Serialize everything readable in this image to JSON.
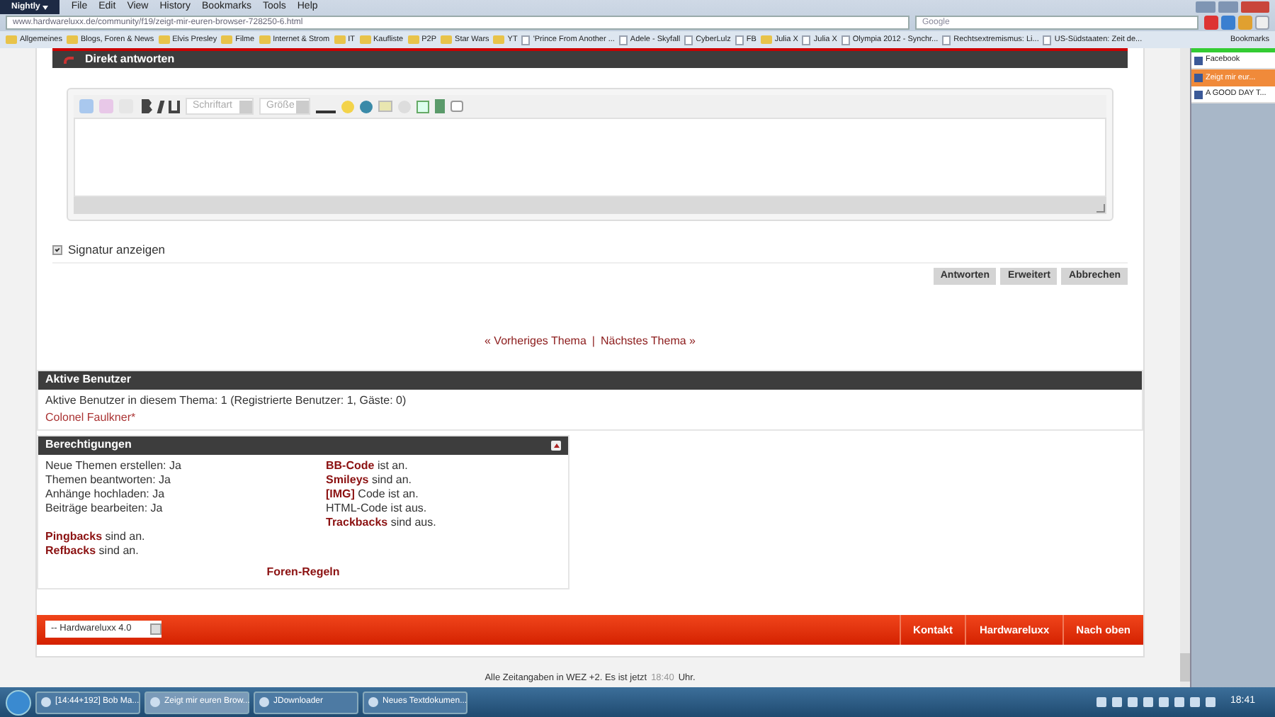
{
  "browser": {
    "app_button": "Nightly",
    "menu": [
      "File",
      "Edit",
      "View",
      "History",
      "Bookmarks",
      "Tools",
      "Help"
    ],
    "url": "www.hardwareluxx.de/community/f19/zeigt-mir-euren-browser-728250-6.html",
    "search_placeholder": "Google",
    "bookmarks": [
      {
        "label": "Allgemeines",
        "kind": "folder"
      },
      {
        "label": "Blogs, Foren & News",
        "kind": "folder"
      },
      {
        "label": "Elvis Presley",
        "kind": "folder"
      },
      {
        "label": "Filme",
        "kind": "folder"
      },
      {
        "label": "Internet & Strom",
        "kind": "folder"
      },
      {
        "label": "IT",
        "kind": "folder"
      },
      {
        "label": "Kaufliste",
        "kind": "folder"
      },
      {
        "label": "P2P",
        "kind": "folder"
      },
      {
        "label": "Star Wars",
        "kind": "folder"
      },
      {
        "label": "YT",
        "kind": "folder"
      },
      {
        "label": "'Prince From Another ...",
        "kind": "page"
      },
      {
        "label": "Adele - Skyfall",
        "kind": "page"
      },
      {
        "label": "CyberLulz",
        "kind": "page"
      },
      {
        "label": "FB",
        "kind": "page"
      },
      {
        "label": "Julia X",
        "kind": "folder"
      },
      {
        "label": "Julia X",
        "kind": "page"
      },
      {
        "label": "Olympia 2012 - Synchr...",
        "kind": "page"
      },
      {
        "label": "Rechtsextremismus: Li...",
        "kind": "page"
      },
      {
        "label": "US-Südstaaten: Zeit de...",
        "kind": "page"
      }
    ],
    "bookmarks_button": "Bookmarks"
  },
  "sidebar": {
    "items": [
      {
        "label": "Facebook",
        "selected": false
      },
      {
        "label": "Zeigt mir eur...",
        "selected": true
      },
      {
        "label": "A GOOD DAY T...",
        "selected": false
      }
    ]
  },
  "reply": {
    "title": "Direkt antworten",
    "font_placeholder": "Schriftart",
    "size_placeholder": "Größe",
    "signature": {
      "label": "Signatur anzeigen",
      "checked": true
    },
    "buttons": [
      "Antworten",
      "Erweitert",
      "Abbrechen"
    ]
  },
  "thread_nav": {
    "previous": "« Vorheriges Thema",
    "separator": "|",
    "next": "Nächstes Thema »"
  },
  "active_users": {
    "title": "Aktive Benutzer",
    "summary": "Aktive Benutzer in diesem Thema: 1 (Registrierte Benutzer: 1, Gäste: 0)",
    "users": [
      "Colonel Faulkner*"
    ]
  },
  "permissions": {
    "title": "Berechtigungen",
    "left": [
      "Neue Themen erstellen: Ja",
      "Themen beantworten: Ja",
      "Anhänge hochladen: Ja",
      "Beiträge bearbeiten: Ja"
    ],
    "left_extra": [
      "**Pingbacks** sind an.",
      "**Refbacks** sind an."
    ],
    "right": [
      "**BB-Code** ist an.",
      "**Smileys** sind an.",
      "**[IMG]** Code ist an.",
      "HTML-Code ist aus.",
      "**Trackbacks** sind aus."
    ],
    "rules_link": "Foren-Regeln"
  },
  "footer": {
    "style_select": "-- Hardwareluxx 4.0",
    "links": [
      "Kontakt",
      "Hardwareluxx",
      "Nach oben"
    ],
    "time_note": "Alle Zeitangaben in WEZ +2. Es ist jetzt",
    "time": "18:40",
    "time_suffix": "Uhr."
  },
  "taskbar": {
    "tasks": [
      {
        "label": "[14:44+192] Bob Ma...",
        "selected": false
      },
      {
        "label": "Zeigt mir euren Brow...",
        "selected": true
      },
      {
        "label": "JDownloader",
        "selected": false
      },
      {
        "label": "Neues Textdokumen...",
        "selected": false
      }
    ],
    "clock": "18:41"
  }
}
